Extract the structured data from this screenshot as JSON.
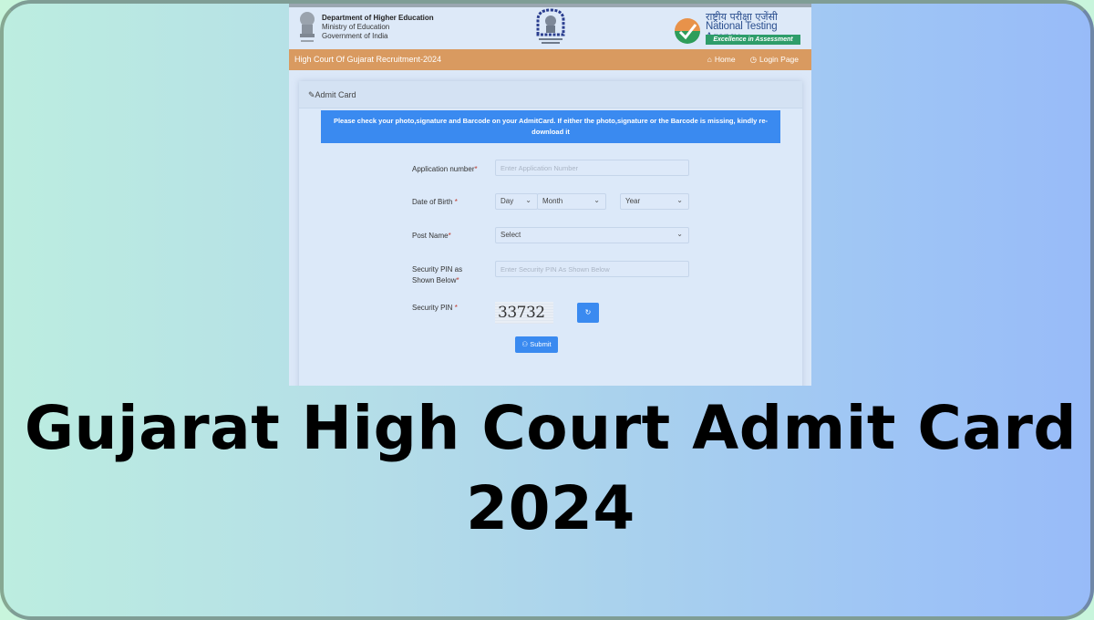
{
  "header": {
    "dept_line1": "Department of Higher Education",
    "dept_line2": "Ministry of Education",
    "dept_line3": "Government of India",
    "hc_logo_alt": "The High Court of Gujarat",
    "nta_hindi": "राष्ट्रीय परीक्षा एजेंसी",
    "nta_name": "National Testing Agency",
    "nta_tagline": "Excellence in Assessment"
  },
  "navbar": {
    "title": "High Court Of Gujarat Recruitment-2024",
    "home_label": "Home",
    "login_label": "Login Page",
    "home_icon": "⌂",
    "login_icon": "◷"
  },
  "card": {
    "title": "Admit Card",
    "title_icon": "✎",
    "notice": "Please check your photo,signature and Barcode on your AdmitCard. If either the photo,signature or the Barcode is missing, kindly re-download it"
  },
  "form": {
    "application_label": "Application number",
    "application_placeholder": "Enter Application Number",
    "dob_label": "Date of Birth ",
    "dob_day": "Day",
    "dob_month": "Month",
    "dob_year": "Year",
    "post_label": "Post Name",
    "post_value": "Select",
    "pin_input_label_1": "Security PIN as",
    "pin_input_label_2": "Shown Below",
    "pin_placeholder": "Enter Security PIN As Shown Below",
    "pin_label": "Security PIN ",
    "captcha_value": "33732",
    "refresh_icon": "↻",
    "submit_label": "Submit",
    "submit_icon": "⚇",
    "required_mark": "*",
    "chevron": "⌄"
  },
  "headline": {
    "line1": "Gujarat High Court Admit Card",
    "line2": "2024"
  }
}
